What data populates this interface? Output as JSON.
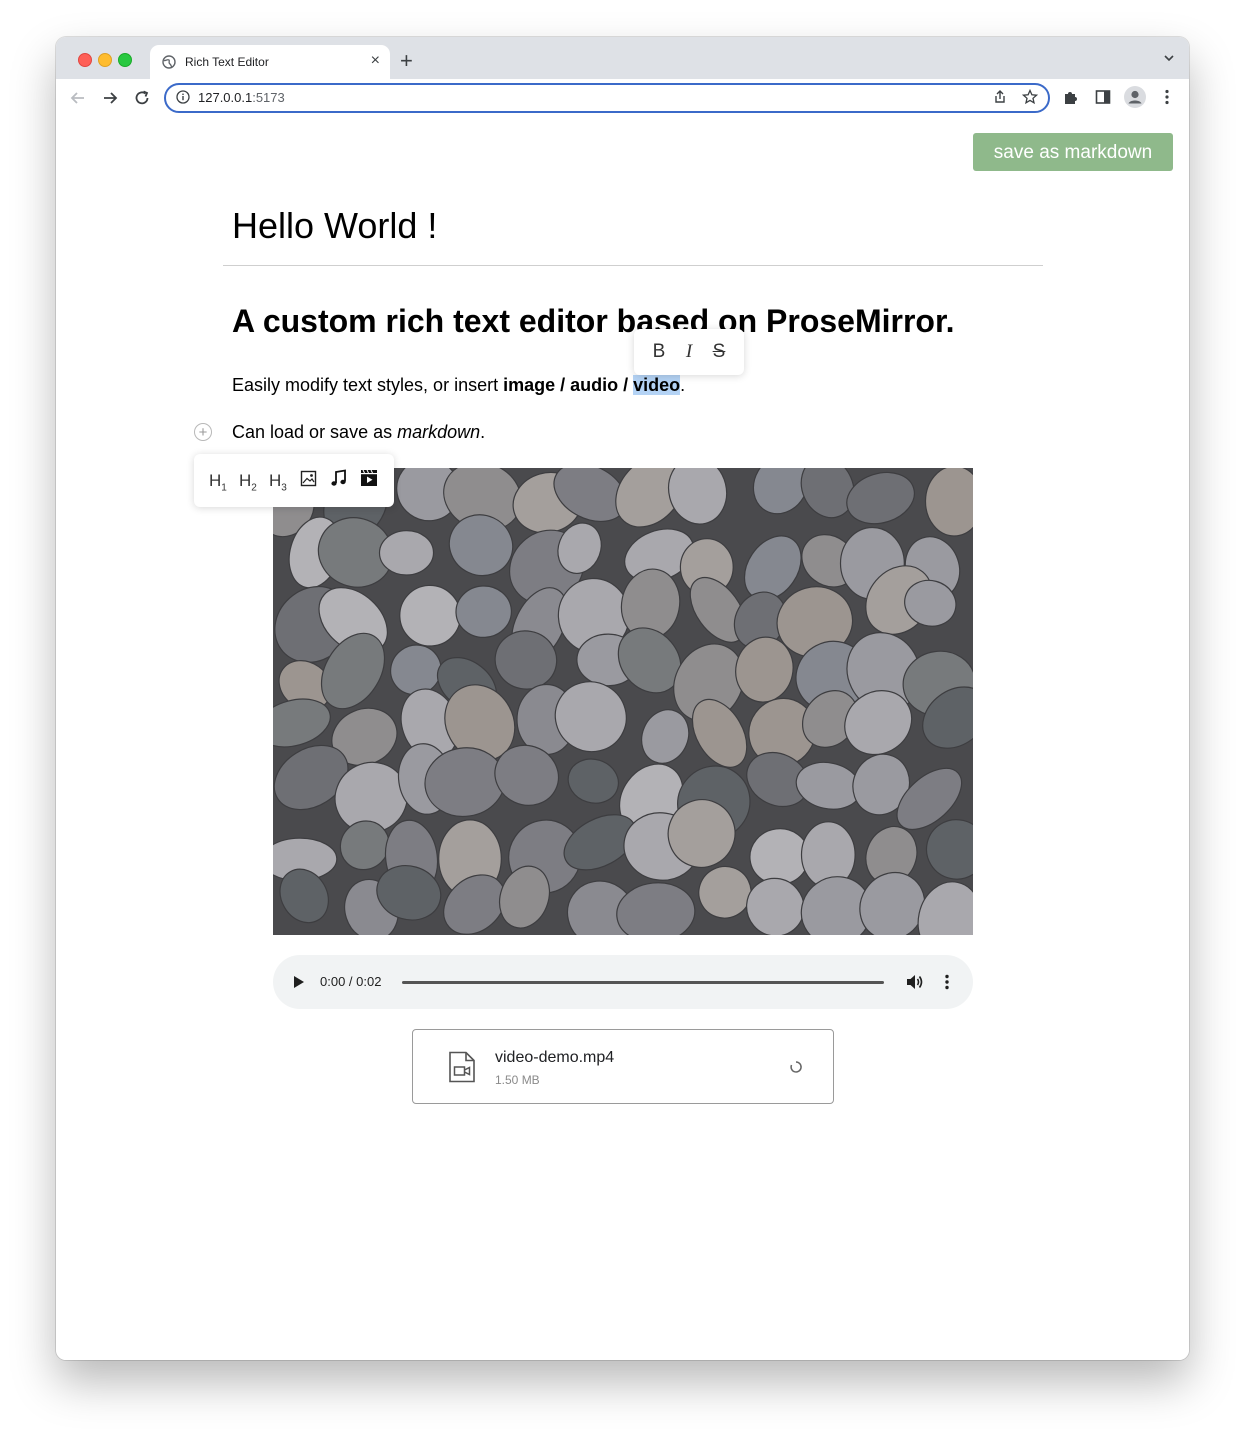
{
  "browser": {
    "tab_title": "Rich Text Editor",
    "tab_close": "×",
    "new_tab": "+",
    "url_host": "127.0.0.1",
    "url_port": ":5173"
  },
  "editor": {
    "save_button": "save as markdown",
    "doc_title": "Hello World !",
    "heading": "A custom rich text editor based on ProseMirror.",
    "paragraph1": {
      "text_a": "Easily modify text styles, or insert ",
      "bold_image": "image",
      "sep1": " / ",
      "bold_audio": "audio",
      "sep2": " / ",
      "bold_video": "video",
      "end": "."
    },
    "paragraph2": {
      "text_a": "Can load or save as ",
      "italic": "markdown",
      "end": "."
    },
    "plus_button": "+",
    "format_toolbar": {
      "bold": "B",
      "italic": "I",
      "strike": "S"
    },
    "block_menu": {
      "h1": "H",
      "h1_sub": "1",
      "h2": "H",
      "h2_sub": "2",
      "h3": "H",
      "h3_sub": "3",
      "icons": [
        "image-icon",
        "music-icon",
        "video-icon"
      ]
    },
    "image": {
      "alt": "pebbles"
    },
    "audio": {
      "time": "0:00 / 0:02"
    },
    "file": {
      "name": "video-demo.mp4",
      "size": "1.50 MB"
    }
  },
  "colors": {
    "save_button_bg": "#8fb98b",
    "selection": "#b4d3f5",
    "omnibox_border": "#3b6ac9"
  }
}
